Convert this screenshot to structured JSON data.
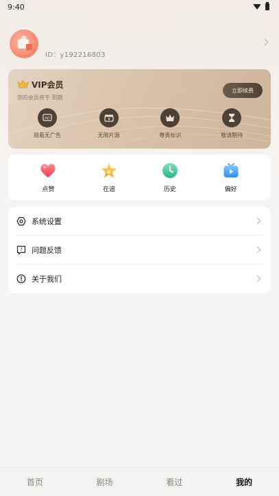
{
  "status_bar": {
    "time": "9:40"
  },
  "profile": {
    "user_id": "ID：y192216803"
  },
  "vip": {
    "title": "VIP会员",
    "subtitle": "您的会员将于 到期",
    "renew_label": "立即续费",
    "benefits": [
      {
        "label": "观看无广告",
        "icon": "ad-free-icon"
      },
      {
        "label": "无限片源",
        "icon": "clapperboard-icon"
      },
      {
        "label": "尊贵标识",
        "icon": "crown-icon"
      },
      {
        "label": "敬请期待",
        "icon": "hourglass-icon"
      }
    ]
  },
  "quick_actions": [
    {
      "label": "点赞",
      "icon": "heart-icon",
      "color": "#f0545f"
    },
    {
      "label": "在追",
      "icon": "star-icon",
      "color": "#f4b52e"
    },
    {
      "label": "历史",
      "icon": "clock-icon",
      "color": "#3fc49a"
    },
    {
      "label": "偏好",
      "icon": "tv-icon",
      "color": "#3d9df0"
    }
  ],
  "menu": [
    {
      "label": "系统设置",
      "icon": "settings-hexagon-icon"
    },
    {
      "label": "问题反馈",
      "icon": "feedback-question-icon"
    },
    {
      "label": "关于我们",
      "icon": "info-circle-icon"
    }
  ],
  "bottom_nav": [
    {
      "label": "首页",
      "active": false
    },
    {
      "label": "剧场",
      "active": false
    },
    {
      "label": "看过",
      "active": false
    },
    {
      "label": "我的",
      "active": true
    }
  ]
}
